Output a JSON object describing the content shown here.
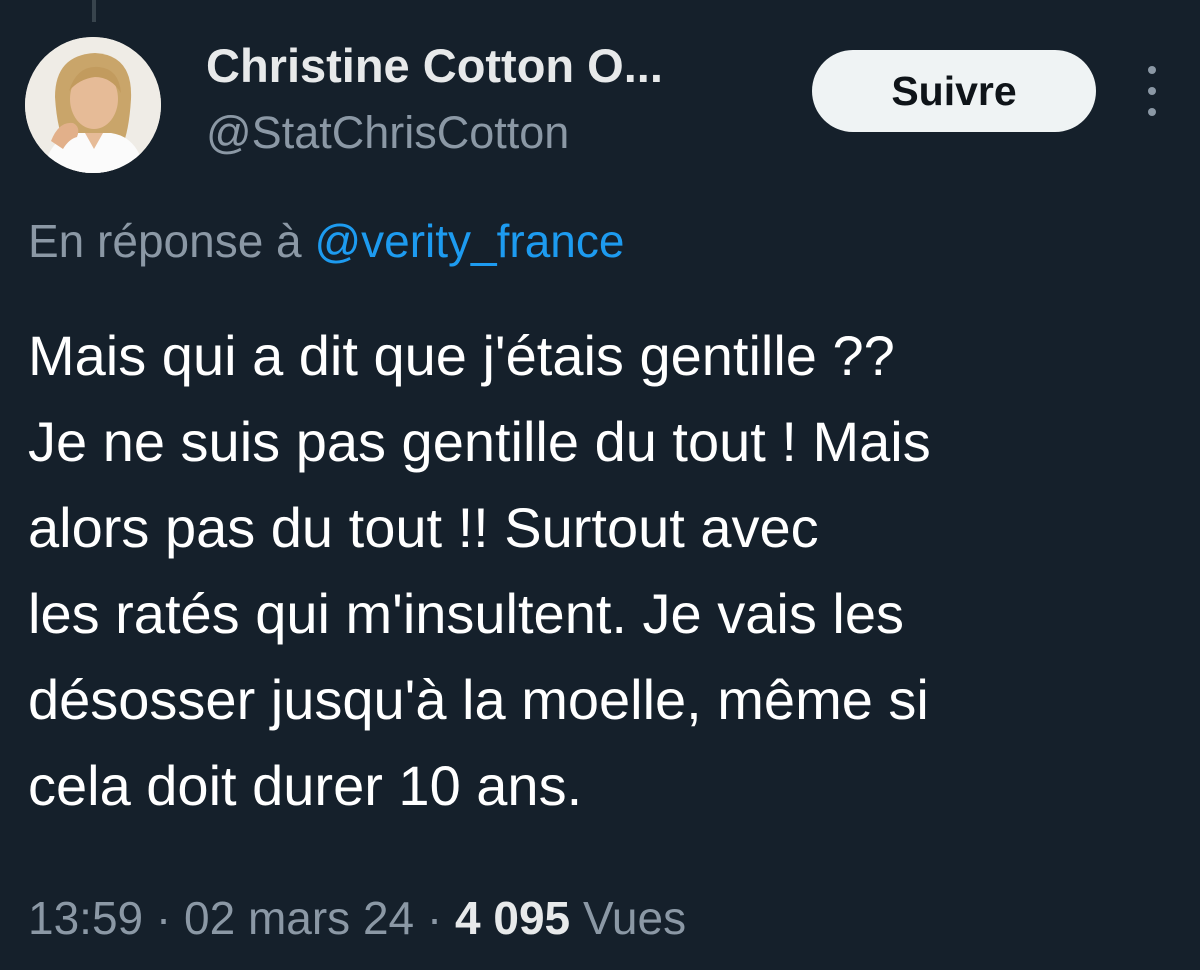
{
  "author": {
    "display_name": "Christine Cotton O...",
    "handle": "@StatChrisCotton"
  },
  "actions": {
    "follow_label": "Suivre",
    "more_icon": "more-vertical-icon"
  },
  "reply": {
    "prefix": "En réponse à",
    "mention": "@verity_france"
  },
  "tweet": {
    "lines": [
      "Mais qui a dit que j'étais gentille ??",
      "Je ne suis pas gentille du tout !  Mais",
      "alors pas du tout !! Surtout avec",
      "les ratés qui m'insultent. Je vais les",
      "désosser jusqu'à la moelle, même si",
      "cela doit durer 10 ans."
    ]
  },
  "meta": {
    "time": "13:59",
    "date": "02 mars 24",
    "separator": " · ",
    "views_count": "4 095",
    "views_label": "Vues"
  },
  "colors": {
    "background": "#15202b",
    "primary_text": "#e7e9ea",
    "secondary_text": "#8b98a5",
    "link": "#1d9bf0",
    "follow_button_bg": "#eff3f4"
  }
}
